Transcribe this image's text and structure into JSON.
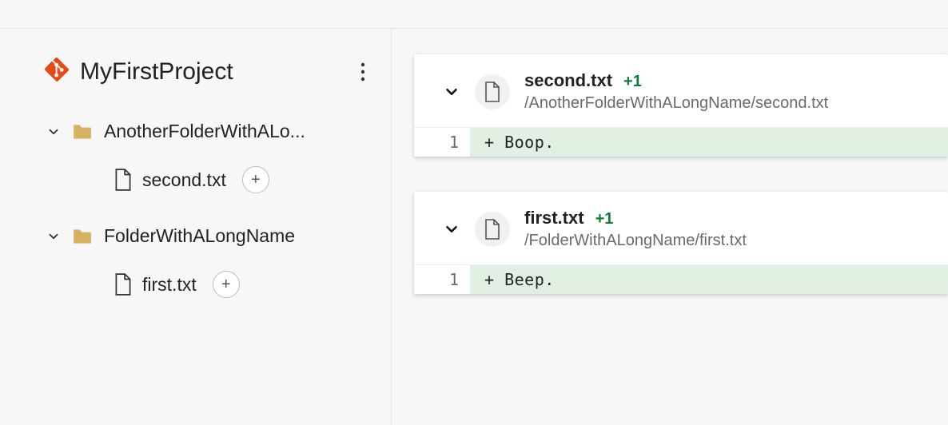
{
  "project": {
    "name": "MyFirstProject"
  },
  "sidebar": {
    "folders": [
      {
        "label": "AnotherFolderWithALo...",
        "expanded": true,
        "files": [
          {
            "label": "second.txt",
            "hasAdd": true
          }
        ]
      },
      {
        "label": "FolderWithALongName",
        "expanded": true,
        "files": [
          {
            "label": "first.txt",
            "hasAdd": true
          }
        ]
      }
    ]
  },
  "diffs": [
    {
      "filename": "second.txt",
      "delta": "+1",
      "path": "/AnotherFolderWithALongName/second.txt",
      "lineNo": "1",
      "code": "+ Boop."
    },
    {
      "filename": "first.txt",
      "delta": "+1",
      "path": "/FolderWithALongName/first.txt",
      "lineNo": "1",
      "code": "+ Beep."
    }
  ],
  "icons": {
    "add": "+"
  }
}
